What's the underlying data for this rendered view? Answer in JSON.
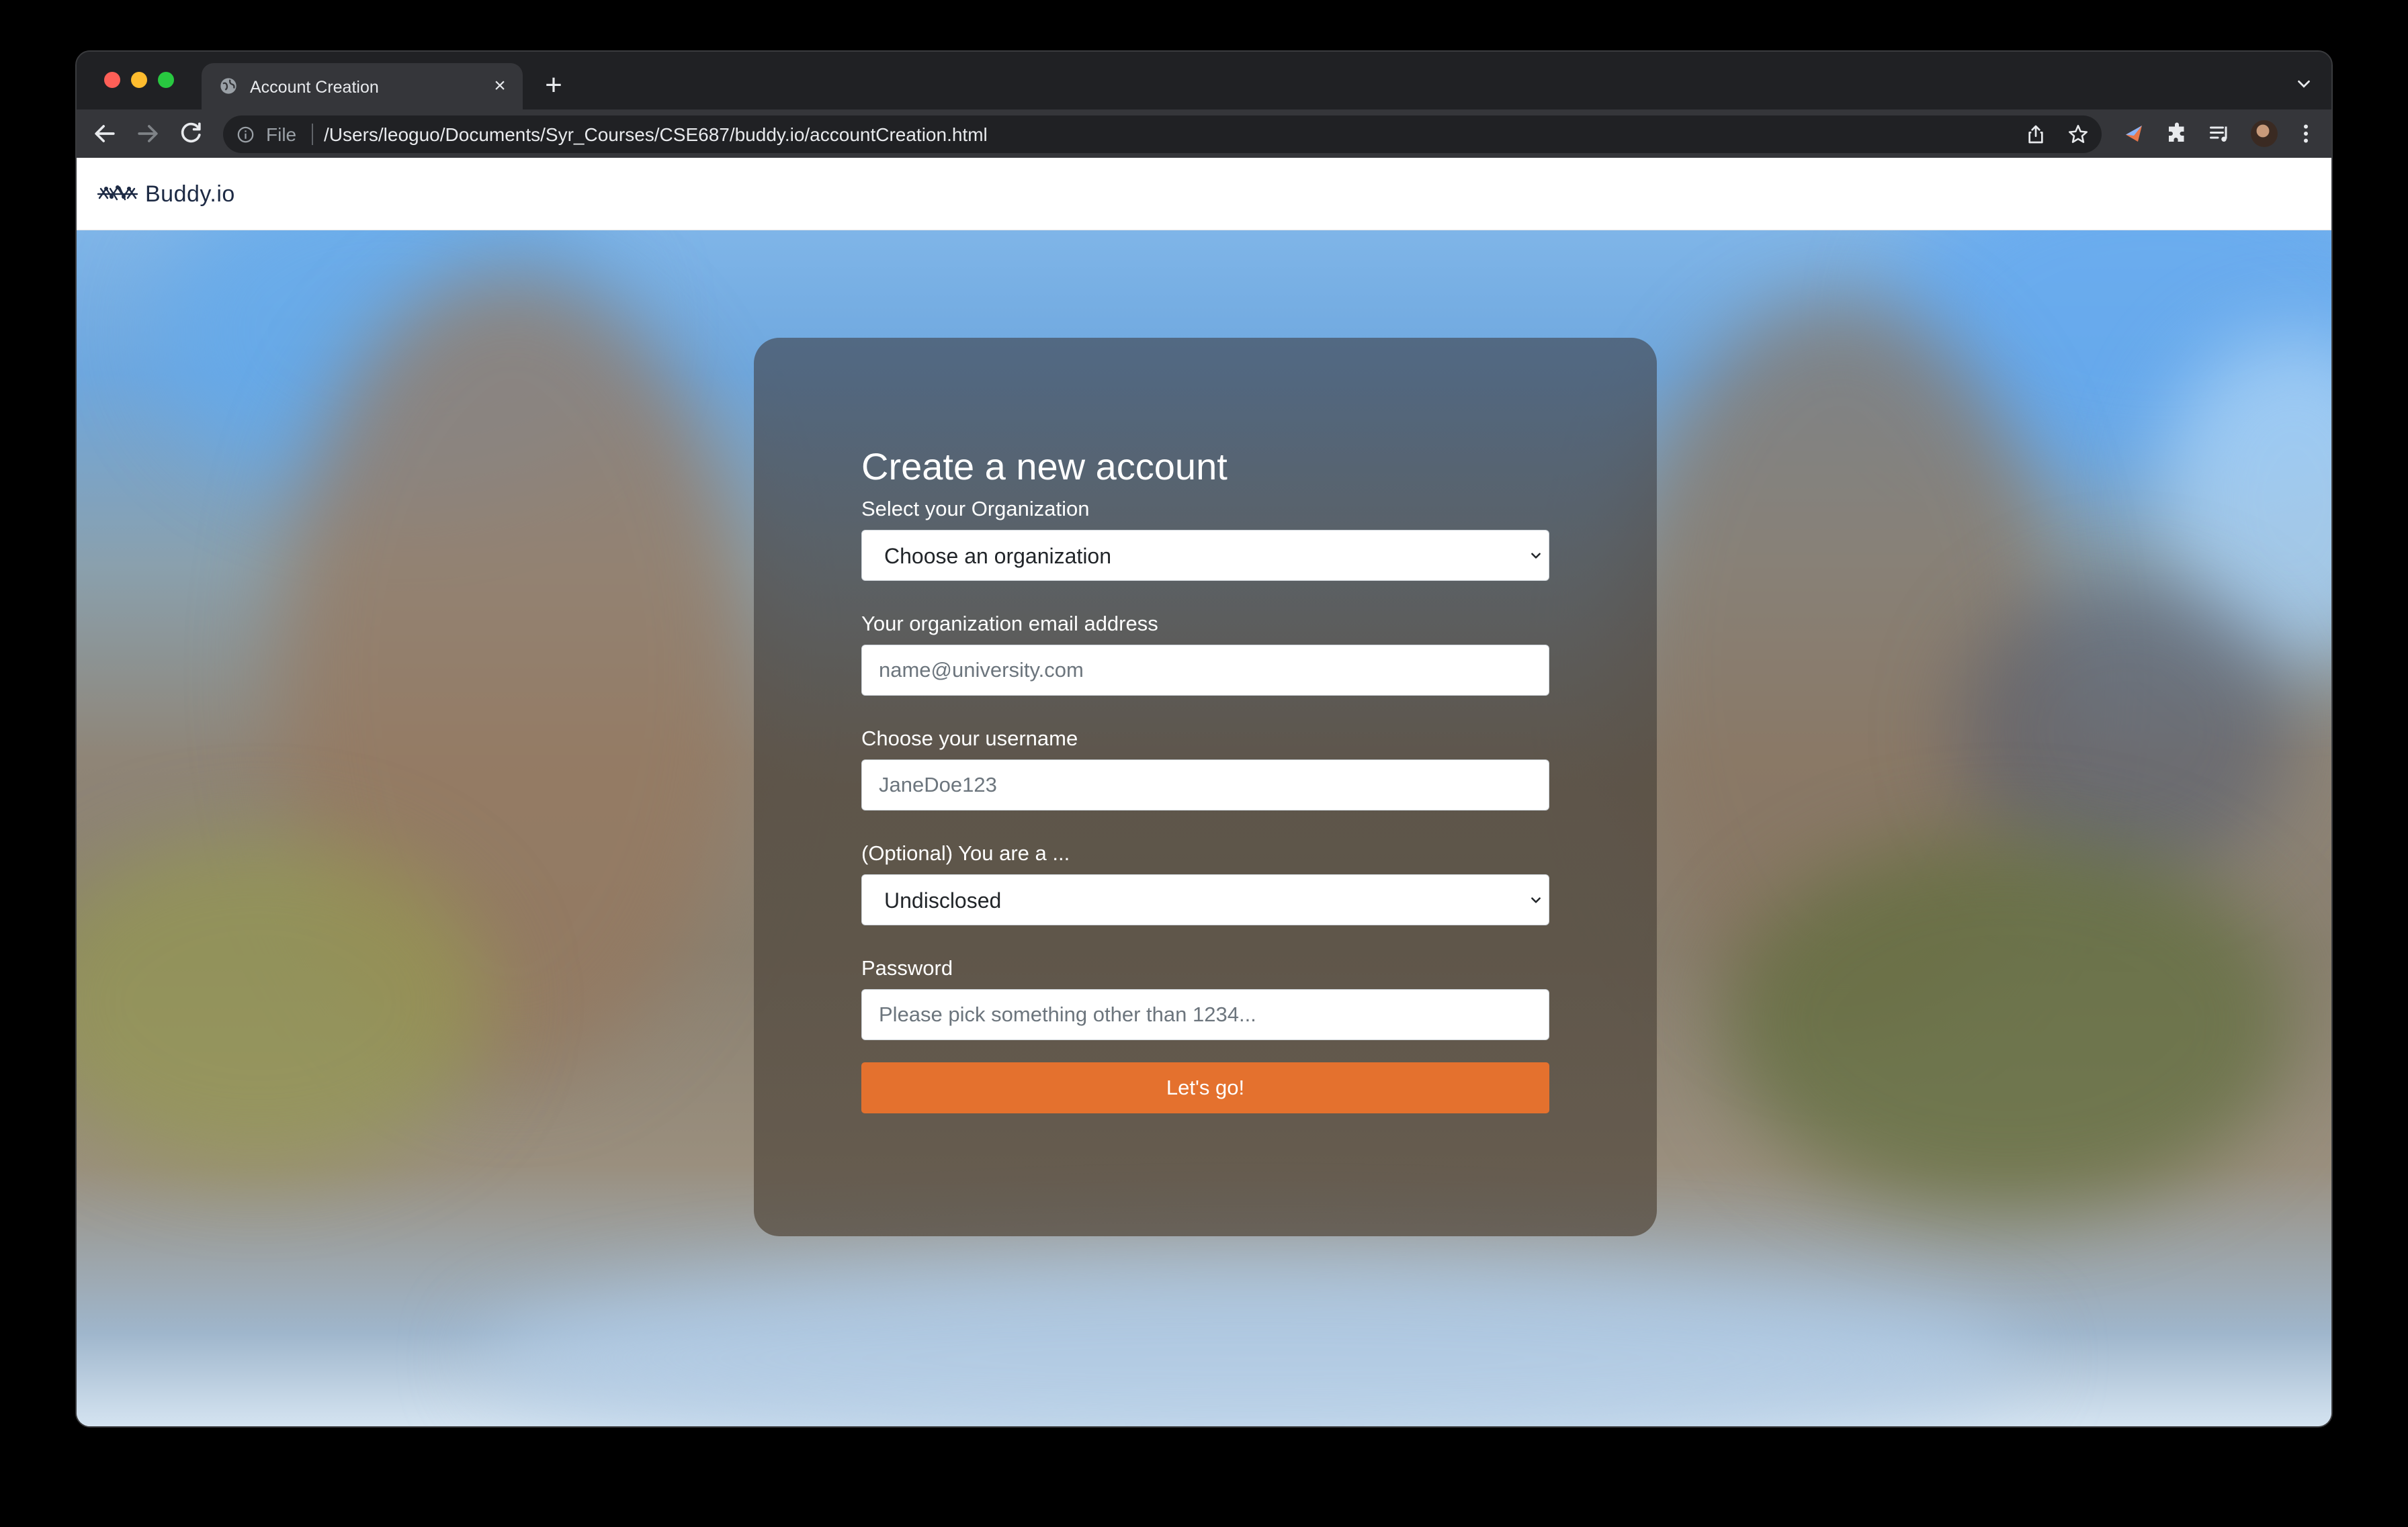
{
  "browser": {
    "tab_title": "Account Creation",
    "new_tab_label": "+",
    "close_label": "×",
    "omnibox": {
      "scheme_label": "File",
      "url": "/Users/leoguo/Documents/Syr_Courses/CSE687/buddy.io/accountCreation.html"
    },
    "icons": [
      "globe-icon",
      "back-icon",
      "forward-icon",
      "reload-icon",
      "info-icon",
      "share-icon",
      "star-icon",
      "extension-icon",
      "puzzle-icon",
      "media-icon",
      "avatar",
      "menu-icon"
    ]
  },
  "navbar": {
    "brand_name": "Buddy.io"
  },
  "form": {
    "title": "Create a new account",
    "organization": {
      "label": "Select your Organization",
      "selected": "Choose an organization"
    },
    "email": {
      "label": "Your organization email address",
      "placeholder": "name@university.com"
    },
    "username": {
      "label": "Choose your username",
      "placeholder": "JaneDoe123"
    },
    "role": {
      "label": "(Optional) You are a ...",
      "selected": "Undisclosed"
    },
    "password": {
      "label": "Password",
      "placeholder": "Please pick something other than 1234..."
    },
    "submit_label": "Let's go!"
  },
  "colors": {
    "accent": "#e4712e",
    "brand_text": "#1d2a44",
    "chrome_dark": "#202124",
    "chrome_toolbar": "#35363a"
  }
}
